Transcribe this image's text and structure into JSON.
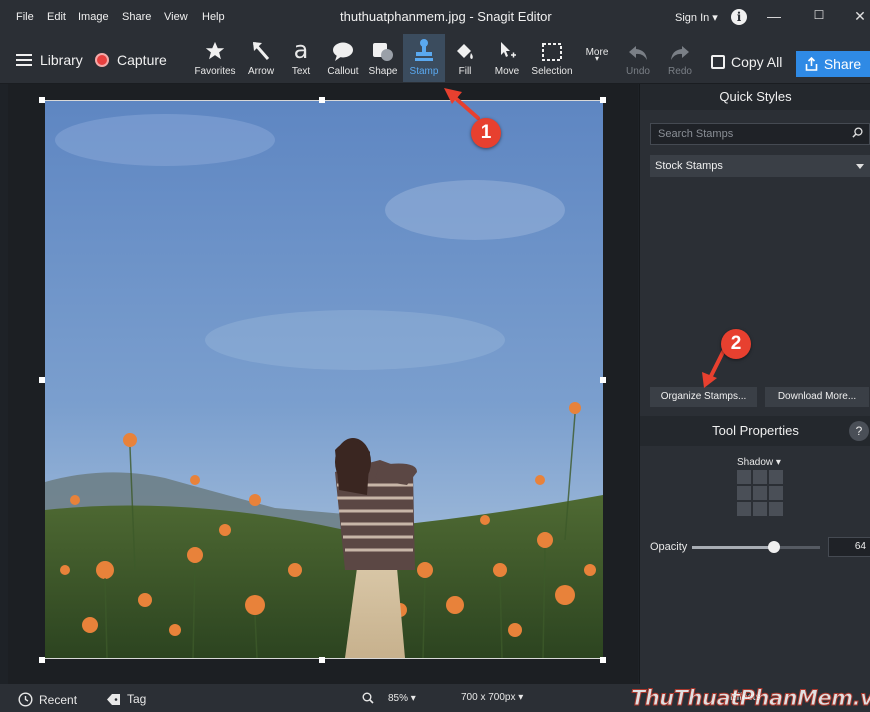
{
  "menubar": {
    "items": [
      "File",
      "Edit",
      "Image",
      "Share",
      "View",
      "Help"
    ],
    "title": "thuthuatphanmem.jpg - Snagit Editor",
    "signin": "Sign In ▾"
  },
  "toolbar": {
    "library": "Library",
    "capture": "Capture",
    "tools": [
      "Favorites",
      "Arrow",
      "Text",
      "Callout",
      "Shape",
      "Stamp",
      "Fill",
      "Move",
      "Selection",
      "More",
      "Undo",
      "Redo"
    ],
    "active_tool": "Stamp",
    "copy_all": "Copy All",
    "share": "Share"
  },
  "panel": {
    "quick_styles": "Quick Styles",
    "search_placeholder": "Search Stamps",
    "stock_stamps": "Stock Stamps",
    "organize": "Organize Stamps...",
    "download": "Download More...",
    "tool_properties": "Tool Properties",
    "help": "?",
    "shadow": "Shadow ▾",
    "opacity_label": "Opacity",
    "opacity_value": "64",
    "opacity_fraction": 0.64
  },
  "statusbar": {
    "recent": "Recent",
    "tag": "Tag",
    "zoom": "85% ▾",
    "size": "700 x 700px ▾",
    "effects": "Effects"
  },
  "annotations": {
    "badge1": "1",
    "badge2": "2"
  },
  "watermark": "ThuThuatPhanMem.vn",
  "colors": {
    "accent": "#2f8ae5",
    "badge": "#e7402f",
    "active_tool_bg": "#3b4c5e"
  }
}
